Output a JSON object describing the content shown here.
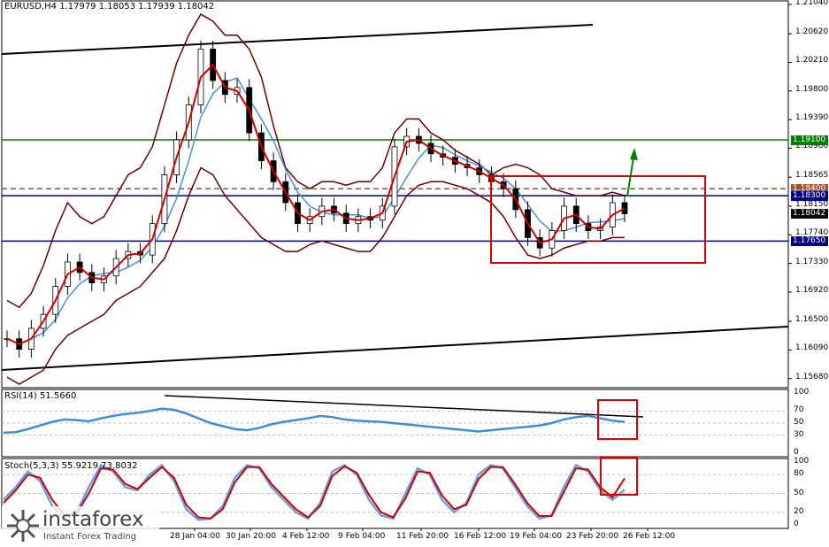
{
  "chart_data": [
    {
      "type": "line",
      "title": "EURUSD,H4  1.17979 1.18053 1.17939 1.18042",
      "ylim": [
        1.156,
        1.2104
      ],
      "price_axis_ticks": [
        "1.21040",
        "1.20620",
        "1.20210",
        "1.19800",
        "1.19390",
        "1.18980",
        "1.18565",
        "1.18150",
        "1.17740",
        "1.17330",
        "1.16920",
        "1.16500",
        "1.16090",
        "1.15680"
      ],
      "time_axis_labels": [
        "28 Jan 04:00",
        "30 Jan 20:00",
        "4 Feb 12:00",
        "9 Feb 04:00",
        "11 Feb 20:00",
        "16 Feb 12:00",
        "19 Feb 04:00",
        "23 Feb 20:00",
        "26 Feb 12:00"
      ],
      "price_tags": [
        {
          "value": "1.19100",
          "color": "#008000"
        },
        {
          "value": "1.18400",
          "color": "#a0522d"
        },
        {
          "value": "1.18300",
          "color": "#000080"
        },
        {
          "value": "1.18042",
          "color": "#000000"
        },
        {
          "value": "1.17650",
          "color": "#000080"
        }
      ],
      "horizontal_levels": [
        {
          "y": 1.191,
          "color": "#008000",
          "style": "solid"
        },
        {
          "y": 1.184,
          "color": "#a0522d",
          "style": "dashed"
        },
        {
          "y": 1.183,
          "color": "#000080",
          "style": "solid"
        },
        {
          "y": 1.1765,
          "color": "#000080",
          "style": "solid"
        }
      ],
      "close": [
        1.1625,
        1.161,
        1.164,
        1.166,
        1.17,
        1.1735,
        1.172,
        1.1705,
        1.1715,
        1.174,
        1.175,
        1.1745,
        1.179,
        1.186,
        1.191,
        1.196,
        1.204,
        1.1995,
        1.1975,
        1.1985,
        1.192,
        1.188,
        1.185,
        1.182,
        1.179,
        1.18,
        1.1815,
        1.1805,
        1.179,
        1.18,
        1.1795,
        1.1815,
        1.19,
        1.1915,
        1.1905,
        1.189,
        1.1885,
        1.1875,
        1.187,
        1.186,
        1.185,
        1.184,
        1.181,
        1.177,
        1.1755,
        1.178,
        1.1815,
        1.179,
        1.178,
        1.1785,
        1.182,
        1.1804
      ],
      "bollinger_upper": [
        1.168,
        1.167,
        1.169,
        1.173,
        1.178,
        1.182,
        1.18,
        1.179,
        1.18,
        1.183,
        1.186,
        1.187,
        1.19,
        1.196,
        1.202,
        1.206,
        1.209,
        1.208,
        1.206,
        1.206,
        1.204,
        1.2,
        1.193,
        1.187,
        1.185,
        1.184,
        1.185,
        1.185,
        1.1845,
        1.185,
        1.185,
        1.187,
        1.192,
        1.194,
        1.194,
        1.192,
        1.191,
        1.1895,
        1.1885,
        1.1875,
        1.186,
        1.187,
        1.1875,
        1.187,
        1.186,
        1.184,
        1.1835,
        1.183,
        1.183,
        1.183,
        1.1835,
        1.183
      ],
      "bollinger_lower": [
        1.157,
        1.156,
        1.157,
        1.158,
        1.161,
        1.163,
        1.164,
        1.165,
        1.166,
        1.168,
        1.169,
        1.17,
        1.172,
        1.174,
        1.178,
        1.183,
        1.187,
        1.186,
        1.183,
        1.181,
        1.179,
        1.177,
        1.176,
        1.175,
        1.175,
        1.176,
        1.1765,
        1.176,
        1.1755,
        1.175,
        1.175,
        1.177,
        1.18,
        1.183,
        1.1845,
        1.185,
        1.185,
        1.1845,
        1.184,
        1.183,
        1.182,
        1.18,
        1.177,
        1.1745,
        1.174,
        1.1745,
        1.1755,
        1.176,
        1.1765,
        1.1765,
        1.177,
        1.177
      ]
    },
    {
      "type": "line",
      "title": "RSI(14) 51.5660",
      "ylim": [
        0,
        100
      ],
      "ticks": [
        "100",
        "70",
        "50",
        "30",
        "0"
      ],
      "values": [
        34,
        35,
        40,
        46,
        52,
        56,
        55,
        53,
        58,
        62,
        65,
        67,
        70,
        74,
        72,
        66,
        58,
        50,
        45,
        40,
        38,
        42,
        48,
        52,
        55,
        58,
        62,
        60,
        56,
        54,
        53,
        52,
        50,
        48,
        46,
        44,
        42,
        40,
        38,
        36,
        38,
        40,
        42,
        44,
        46,
        50,
        56,
        60,
        62,
        58,
        54,
        52
      ]
    },
    {
      "type": "line",
      "title": "Stoch(5,3,3) 55.9219 73.8032",
      "ylim": [
        0,
        100
      ],
      "ticks": [
        "100",
        "80",
        "50",
        "20",
        "0"
      ],
      "values_main": [
        40,
        60,
        85,
        70,
        30,
        10,
        20,
        60,
        95,
        85,
        60,
        55,
        80,
        95,
        70,
        25,
        8,
        10,
        30,
        75,
        95,
        90,
        60,
        40,
        20,
        10,
        35,
        85,
        95,
        80,
        40,
        15,
        10,
        50,
        90,
        80,
        40,
        20,
        35,
        80,
        95,
        90,
        60,
        30,
        10,
        15,
        60,
        95,
        85,
        55,
        40,
        56
      ],
      "values_signal": [
        35,
        55,
        80,
        75,
        40,
        15,
        18,
        50,
        90,
        88,
        65,
        57,
        75,
        92,
        75,
        32,
        12,
        10,
        25,
        68,
        92,
        92,
        65,
        45,
        25,
        12,
        30,
        78,
        93,
        83,
        48,
        20,
        12,
        42,
        85,
        83,
        47,
        25,
        32,
        73,
        92,
        92,
        65,
        35,
        14,
        14,
        52,
        90,
        88,
        60,
        44,
        74
      ]
    }
  ],
  "watermark": {
    "brand": "instaforex",
    "tagline": "Instant Forex Trading"
  }
}
